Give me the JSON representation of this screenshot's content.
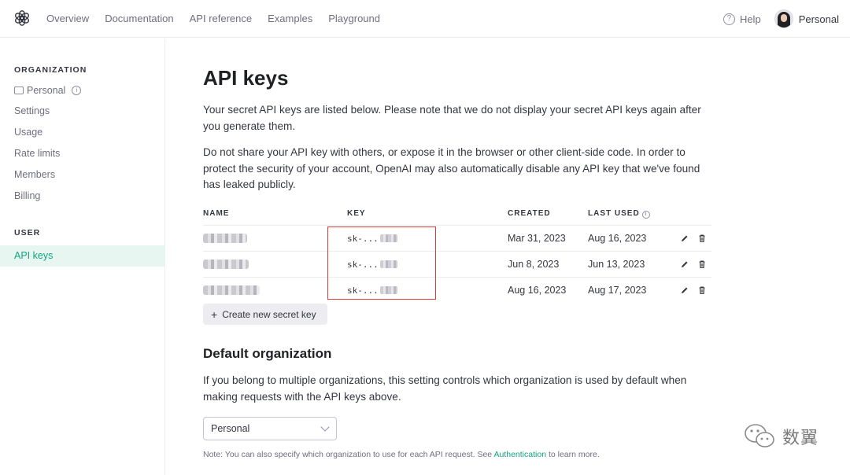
{
  "nav": {
    "links": [
      "Overview",
      "Documentation",
      "API reference",
      "Examples",
      "Playground"
    ],
    "help": "Help",
    "profile": "Personal"
  },
  "sidebar": {
    "organization_heading": "ORGANIZATION",
    "org_name": "Personal",
    "org_items": [
      "Settings",
      "Usage",
      "Rate limits",
      "Members",
      "Billing"
    ],
    "user_heading": "USER",
    "active_item": "API keys"
  },
  "main": {
    "title": "API keys",
    "para1": "Your secret API keys are listed below. Please note that we do not display your secret API keys again after you generate them.",
    "para2": "Do not share your API key with others, or expose it in the browser or other client-side code. In order to protect the security of your account, OpenAI may also automatically disable any API key that we've found has leaked publicly.",
    "table": {
      "headers": {
        "name": "NAME",
        "key": "KEY",
        "created": "CREATED",
        "last_used": "LAST USED"
      },
      "rows": [
        {
          "key": "sk-...",
          "created": "Mar 31, 2023",
          "last_used": "Aug 16, 2023"
        },
        {
          "key": "sk-...",
          "created": "Jun 8, 2023",
          "last_used": "Jun 13, 2023"
        },
        {
          "key": "sk-...",
          "created": "Aug 16, 2023",
          "last_used": "Aug 17, 2023"
        }
      ]
    },
    "create_button": "Create new secret key",
    "default_org_title": "Default organization",
    "default_org_text": "If you belong to multiple organizations, this setting controls which organization is used by default when making requests with the API keys above.",
    "select_value": "Personal",
    "note_prefix": "Note: You can also specify which organization to use for each API request. See ",
    "note_link": "Authentication",
    "note_suffix": " to learn more."
  },
  "watermark": "数翼",
  "colors": {
    "accent": "#10a37f",
    "highlight": "#e03a3a",
    "active_bg": "#e8f6f2"
  }
}
